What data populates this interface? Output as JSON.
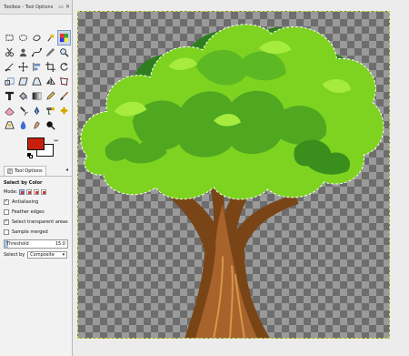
{
  "window": {
    "title": "Toolbox - Tool Options"
  },
  "tools": [
    "rect-select-icon",
    "ellipse-select-icon",
    "free-select-icon",
    "fuzzy-select-icon",
    "select-by-color-icon",
    "scissors-select-icon",
    "foreground-select-icon",
    "paths-icon",
    "color-picker-icon",
    "zoom-icon",
    "measure-icon",
    "move-icon",
    "align-icon",
    "crop-icon",
    "rotate-icon",
    "scale-icon",
    "shear-icon",
    "perspective-icon",
    "flip-icon",
    "cage-transform-icon",
    "text-icon",
    "bucket-fill-icon",
    "blend-icon",
    "pencil-icon",
    "paintbrush-icon",
    "eraser-icon",
    "airbrush-icon",
    "ink-icon",
    "clone-icon",
    "heal-icon",
    "perspective-clone-icon",
    "blur-icon",
    "smudge-icon",
    "dodge-burn-icon"
  ],
  "active_tool_index": 4,
  "colors": {
    "foreground": "#c8200f",
    "background": "#ffffff"
  },
  "tab": {
    "label": "Tool Options"
  },
  "options": {
    "section_title": "Select by Color",
    "mode_label": "Mode:",
    "antialiasing": {
      "label": "Antialiasing",
      "checked": true
    },
    "feather_edges": {
      "label": "Feather edges",
      "checked": false
    },
    "select_transparent": {
      "label": "Select transparent areas",
      "checked": true
    },
    "sample_merged": {
      "label": "Sample merged",
      "checked": false
    },
    "threshold": {
      "label": "Threshold",
      "value": "15.0",
      "fraction": 0.06
    },
    "select_by": {
      "label": "Select by",
      "value": "Composite"
    }
  }
}
